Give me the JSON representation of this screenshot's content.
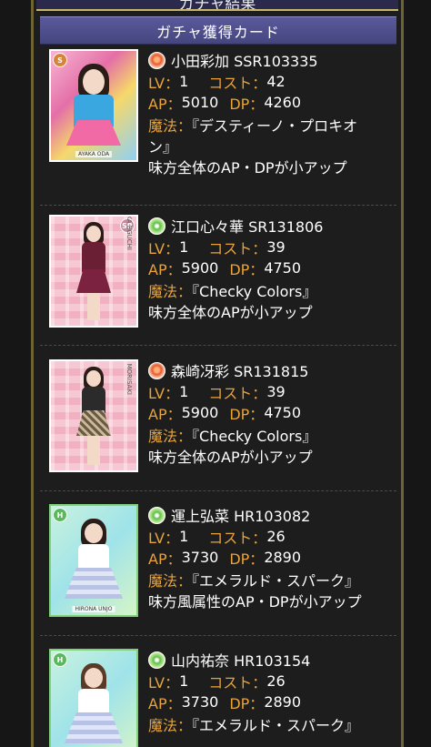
{
  "top_header": {
    "text": "ガチャ結果"
  },
  "section_header": {
    "title": "ガチャ獲得カード"
  },
  "labels": {
    "lv": "LV：",
    "cost": "コスト：",
    "ap": "AP：",
    "dp": "DP：",
    "magic": "魔法："
  },
  "cards": [
    {
      "attribute": "fire",
      "rarity": "SSR",
      "name": "小田彩加 SSR103335",
      "lv": "1",
      "cost": "42",
      "ap": "5010",
      "dp": "4260",
      "magic_line1": "『デスティーノ・プロキオ",
      "magic_line2": "ン』",
      "effect": "味方全体のAP・DPが小アップ",
      "thumb_caption": "AYAKA ODA"
    },
    {
      "attribute": "wind",
      "rarity": "SR",
      "name": "江口心々華 SR131806",
      "lv": "1",
      "cost": "39",
      "ap": "5900",
      "dp": "4750",
      "magic_line1": "『Checky Colors』",
      "effect": "味方全体のAPが小アップ",
      "thumb_caption": "KOKOKA EGUCHI"
    },
    {
      "attribute": "fire",
      "rarity": "SR",
      "name": "森崎冴彩 SR131815",
      "lv": "1",
      "cost": "39",
      "ap": "5900",
      "dp": "4750",
      "magic_line1": "『Checky Colors』",
      "effect": "味方全体のAPが小アップ",
      "thumb_caption": "SAYA MORISAKI"
    },
    {
      "attribute": "wind",
      "rarity": "HR",
      "name": "運上弘菜 HR103082",
      "lv": "1",
      "cost": "26",
      "ap": "3730",
      "dp": "2890",
      "magic_line1": "『エメラルド・スパーク』",
      "effect": "味方風属性のAP・DPが小アップ",
      "thumb_caption": "HIRONA UNJO"
    },
    {
      "attribute": "wind",
      "rarity": "HR",
      "name": "山内祐奈 HR103154",
      "lv": "1",
      "cost": "26",
      "ap": "3730",
      "dp": "2890",
      "magic_line1": "『エメラルド・スパーク』"
    }
  ],
  "colors": {
    "label": "#e9a33b",
    "header_bg": "#4e4e8e",
    "frame_gold": "#6d6433"
  }
}
